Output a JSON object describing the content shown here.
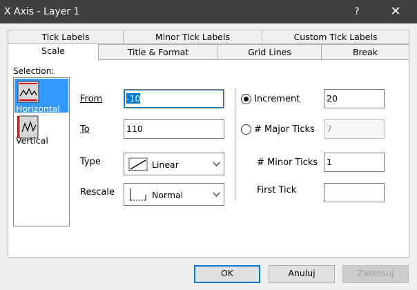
{
  "window": {
    "title": "X Axis - Layer 1",
    "help": "?",
    "close": "✕"
  },
  "tabs": {
    "row1": [
      "Tick Labels",
      "Minor Tick Labels",
      "Custom Tick Labels"
    ],
    "row2": [
      "Scale",
      "Title & Format",
      "Grid Lines",
      "Break"
    ],
    "active": "Scale"
  },
  "selection": {
    "label": "Selection:",
    "items": [
      "Horizontal",
      "Vertical"
    ],
    "selected": "Horizontal"
  },
  "scale": {
    "from_label": "From",
    "from_value": "-10",
    "to_label": "To",
    "to_value": "110",
    "type_label": "Type",
    "type_value": "Linear",
    "rescale_label": "Rescale",
    "rescale_value": "Normal"
  },
  "ticks": {
    "increment_label": "Increment",
    "increment_value": "20",
    "major_label": "# Major Ticks",
    "major_value": "7",
    "minor_label": "# Minor Ticks",
    "minor_value": "1",
    "first_label": "First Tick",
    "first_value": "",
    "selected_mode": "Increment"
  },
  "buttons": {
    "ok": "OK",
    "cancel": "Anuluj",
    "apply": "Zastosuj"
  },
  "colors": {
    "titlebar": "#404040",
    "selection": "#3399ff",
    "focus": "#0078d7"
  }
}
